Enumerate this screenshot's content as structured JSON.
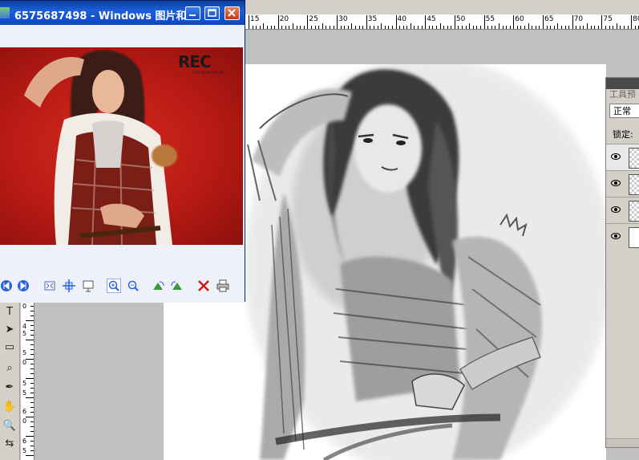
{
  "photoshop": {
    "ruler_h_labels": [
      "15",
      "20",
      "25",
      "30",
      "35",
      "40",
      "45",
      "50",
      "55",
      "60",
      "65",
      "70",
      "75",
      "80"
    ],
    "ruler_v_labels": [
      "0",
      "4",
      "5",
      "5",
      "0",
      "5",
      "5",
      "6",
      "0",
      "6",
      "5"
    ],
    "layers_panel": {
      "tab_label": "工具预",
      "blend_mode": "正常",
      "lock_label": "锁定:",
      "layer_count": 4
    }
  },
  "picture_viewer": {
    "title": "6575687498 - Windows 图片和…",
    "photo": {
      "logo_text": "REC",
      "logo_tagline": "FUEL YOUR DREAM"
    },
    "toolbar_icons": [
      "previous-icon",
      "next-icon",
      "best-fit-icon",
      "actual-size-icon",
      "slideshow-icon",
      "zoom-in-icon",
      "zoom-out-icon",
      "rotate-clockwise-icon",
      "rotate-counterclockwise-icon",
      "delete-icon",
      "print-icon"
    ]
  },
  "colors": {
    "titlebar": "#1c5fd8",
    "photo_red": "#c81e16",
    "delete_red": "#d01818"
  }
}
